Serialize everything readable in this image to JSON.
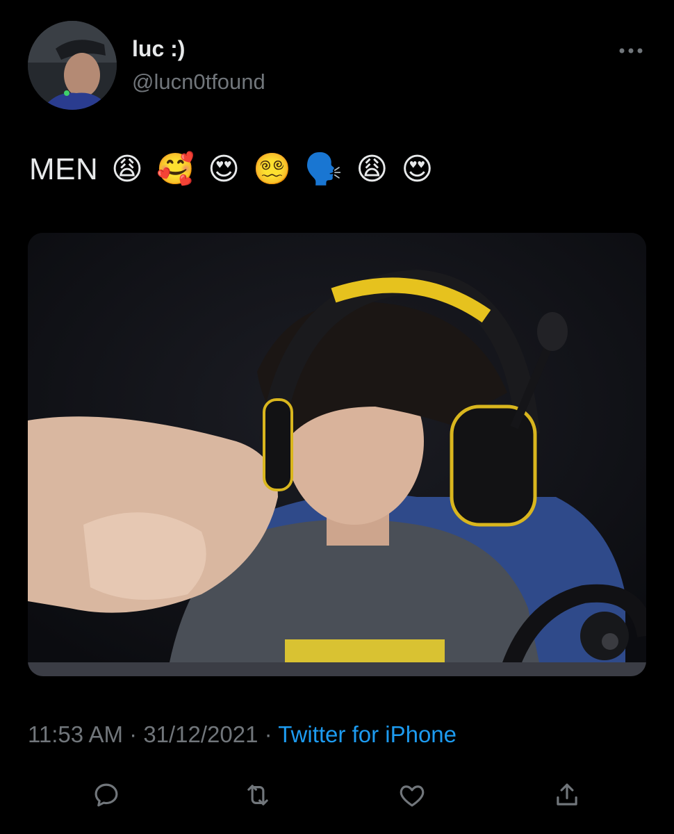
{
  "tweet": {
    "author": {
      "display_name": "luc :)",
      "handle": "@lucn0tfound"
    },
    "text": "MEN",
    "emojis": [
      "😩",
      "🥰",
      "😍",
      "😵‍💫",
      "🗣️",
      "😩",
      "😍"
    ],
    "time": "11:53 AM",
    "date": "31/12/2021",
    "source": "Twitter for iPhone",
    "separator": " · "
  },
  "icons": {
    "more": "more-horizontal-icon",
    "reply": "reply-icon",
    "retweet": "retweet-icon",
    "like": "heart-icon",
    "share": "share-icon"
  },
  "colors": {
    "background": "#000000",
    "primary_text": "#e7e9ea",
    "secondary_text": "#71767b",
    "link": "#1d9bf0"
  }
}
